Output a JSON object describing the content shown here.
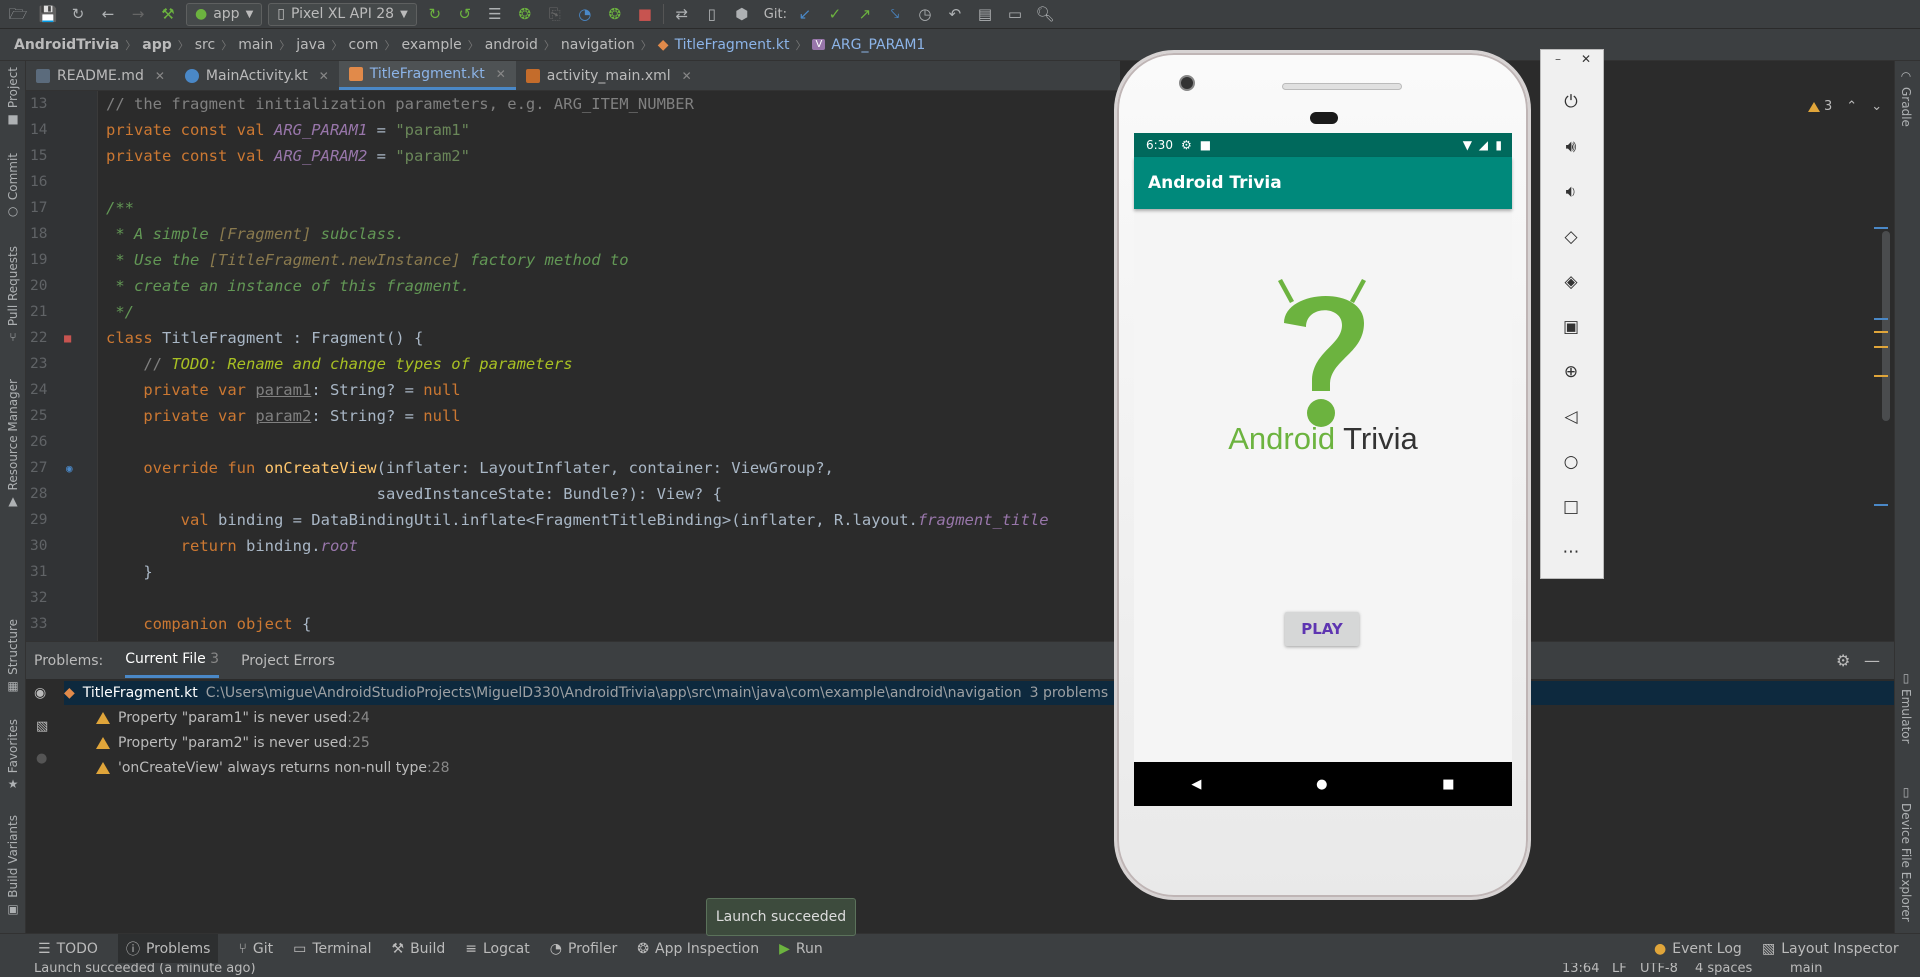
{
  "toolbar": {
    "run_config": "app",
    "device": "Pixel XL API 28",
    "git_label": "Git:"
  },
  "breadcrumb": [
    "AndroidTrivia",
    "app",
    "src",
    "main",
    "java",
    "com",
    "example",
    "android",
    "navigation",
    "TitleFragment.kt",
    "ARG_PARAM1"
  ],
  "tabs": [
    {
      "label": "README.md",
      "active": false
    },
    {
      "label": "MainActivity.kt",
      "active": false
    },
    {
      "label": "TitleFragment.kt",
      "active": true
    },
    {
      "label": "activity_main.xml",
      "active": false
    }
  ],
  "left_tools": [
    "Project",
    "Commit",
    "Pull Requests",
    "Resource Manager",
    "Structure",
    "Favorites",
    "Build Variants"
  ],
  "right_tools": [
    "Gradle",
    "Emulator",
    "Device File Explorer"
  ],
  "editor": {
    "warning_count": "3",
    "line_numbers": [
      "13",
      "14",
      "15",
      "16",
      "17",
      "18",
      "19",
      "20",
      "21",
      "22",
      "23",
      "24",
      "25",
      "26",
      "27",
      "28",
      "29",
      "30",
      "31",
      "32",
      "33"
    ]
  },
  "code": {
    "l13": "// the fragment initialization parameters, e.g. ARG_ITEM_NUMBER",
    "l14_kw": "private const val ",
    "l14_name": "ARG_PARAM1",
    "l14_eq": " = ",
    "l14_str": "\"param1\"",
    "l15_kw": "private const val ",
    "l15_name": "ARG_PARAM2",
    "l15_eq": " = ",
    "l15_str": "\"param2\"",
    "l17": "/**",
    "l18_a": " * A simple ",
    "l18_b": "[Fragment]",
    "l18_c": " subclass.",
    "l19_a": " * Use the ",
    "l19_b": "[TitleFragment.newInstance]",
    "l19_c": " factory method to",
    "l20": " * create an instance of this fragment.",
    "l21": " */",
    "l22_kw": "class ",
    "l22_rest": "TitleFragment : Fragment() {",
    "l23_a": "    // ",
    "l23_b": "TODO: Rename and change types of parameters",
    "l24_kw": "    private var ",
    "l24_name": "param1",
    "l24_rest": ": String? = ",
    "l24_null": "null",
    "l25_kw": "    private var ",
    "l25_name": "param2",
    "l25_rest": ": String? = ",
    "l25_null": "null",
    "l27_kw": "    override fun ",
    "l27_fn": "onCreateView",
    "l27_rest": "(inflater: LayoutInflater, container: ViewGroup?,",
    "l28": "                             savedInstanceState: Bundle?): View? {",
    "l29_kw": "        val ",
    "l29_rest": "binding = DataBindingUtil.inflate<FragmentTitleBinding>(inflater, R.layout.",
    "l29_it": "fragment_title",
    "l30_kw": "        return ",
    "l30_rest": "binding.",
    "l30_it": "root",
    "l31": "    }",
    "l33_kw": "    companion object ",
    "l33_rest": "{"
  },
  "problems": {
    "label": "Problems:",
    "tabs": [
      {
        "label": "Current File",
        "count": "3",
        "active": true
      },
      {
        "label": "Project Errors",
        "active": false
      }
    ],
    "file": "TitleFragment.kt",
    "path": "C:\\Users\\migue\\AndroidStudioProjects\\MiguelD330\\AndroidTrivia\\app\\src\\main\\java\\com\\example\\android\\navigation",
    "summary": "3 problems",
    "items": [
      {
        "text": "Property \"param1\" is never used",
        "line": ":24"
      },
      {
        "text": "Property \"param2\" is never used",
        "line": ":25"
      },
      {
        "text": "'onCreateView' always returns non-null type",
        "line": ":28"
      }
    ]
  },
  "toast": "Launch succeeded",
  "bottom_tools": [
    "TODO",
    "Problems",
    "Git",
    "Terminal",
    "Build",
    "Logcat",
    "Profiler",
    "App Inspection",
    "Run"
  ],
  "bottom_right": [
    "Event Log",
    "Layout Inspector"
  ],
  "status": {
    "message": "Launch succeeded (a minute ago)",
    "position": "13:64",
    "line_sep": "LF",
    "encoding": "UTF-8",
    "indent": "4 spaces",
    "branch": "main"
  },
  "phone": {
    "time": "6:30",
    "app_title": "Android Trivia",
    "logo_text_green": "Android",
    "logo_text_dark": "Trivia",
    "play_label": "PLAY",
    "colors": {
      "primary": "#00897b",
      "primary_dark": "#00695c",
      "logo_green": "#6cb33f",
      "button_text": "#5e35b1"
    }
  },
  "colors": {
    "accent": "#4a88c7",
    "warning": "#e0a53a",
    "toast_bg": "#3d4b3d"
  }
}
